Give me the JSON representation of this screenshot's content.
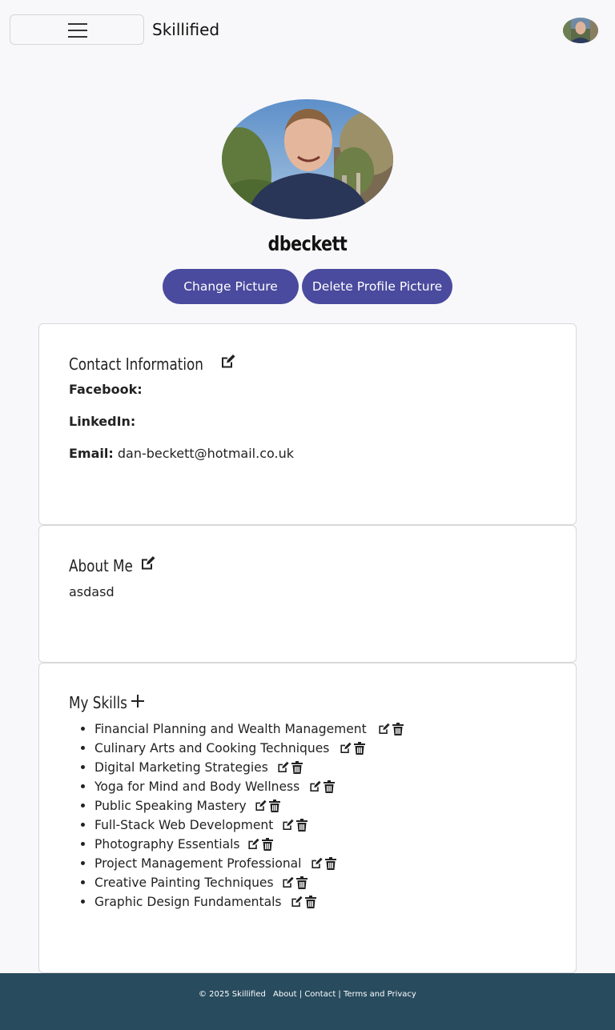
{
  "navbar": {
    "brand": "Skillified",
    "menu_icon": "hamburger-icon",
    "avatar_icon": "user-avatar"
  },
  "profile": {
    "username": "dbeckett",
    "change_picture_label": "Change Picture",
    "delete_picture_label": "Delete Profile Picture"
  },
  "contact": {
    "title": "Contact Information",
    "edit_icon": "edit-icon",
    "facebook_label": "Facebook:",
    "facebook_value": "",
    "linkedin_label": "LinkedIn:",
    "linkedin_value": "",
    "email_label": "Email:",
    "email_value": "dan-beckett@hotmail.co.uk"
  },
  "about": {
    "title": "About Me",
    "edit_icon": "edit-icon",
    "text": "asdasd"
  },
  "skills": {
    "title": "My Skills",
    "add_icon": "plus-icon",
    "items": [
      "Financial Planning and Wealth Management",
      "Culinary Arts and Cooking Techniques",
      "Digital Marketing Strategies",
      "Yoga for Mind and Body Wellness",
      "Public Speaking Mastery",
      "Full-Stack Web Development",
      "Photography Essentials",
      "Project Management Professional",
      "Creative Painting Techniques",
      "Graphic Design Fundamentals"
    ]
  },
  "footer": {
    "copyright": "© 2025 Skillified",
    "about_link": "About",
    "contact_link": "Contact",
    "terms_link": "Terms and Privacy",
    "separator": "|"
  },
  "colors": {
    "button": "#4a4a9e",
    "footer": "#284b5e",
    "background": "#f8f8fa"
  }
}
